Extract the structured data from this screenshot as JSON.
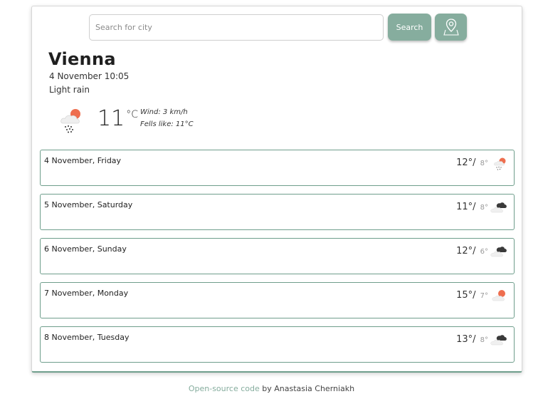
{
  "search": {
    "placeholder": "Search for city",
    "button_label": "Search"
  },
  "current": {
    "city": "Vienna",
    "datetime": "4 November 10:05",
    "description": "Light rain",
    "temperature": "11",
    "unit": "°C",
    "wind": "Wind: 3 km/h",
    "feels_like": "Fells like: 11°C",
    "icon": "light-rain-sun-icon"
  },
  "forecast": [
    {
      "label": "4 November, Friday",
      "max": "12°",
      "min": "8°",
      "icon": "light-rain-sun-icon"
    },
    {
      "label": "5 November, Saturday",
      "max": "11°",
      "min": "8°",
      "icon": "cloudy-icon"
    },
    {
      "label": "6 November, Sunday",
      "max": "12°",
      "min": "6°",
      "icon": "cloudy-icon"
    },
    {
      "label": "7 November, Monday",
      "max": "15°",
      "min": "7°",
      "icon": "partly-cloudy-icon"
    },
    {
      "label": "8 November, Tuesday",
      "max": "13°",
      "min": "8°",
      "icon": "cloudy-icon"
    }
  ],
  "footer": {
    "link_text": "Open-source code",
    "suffix": " by Anastasia Cherniakh"
  },
  "colors": {
    "accent": "#86ad9e",
    "border": "#6f9e8c",
    "sun": "#ee6e4f"
  }
}
